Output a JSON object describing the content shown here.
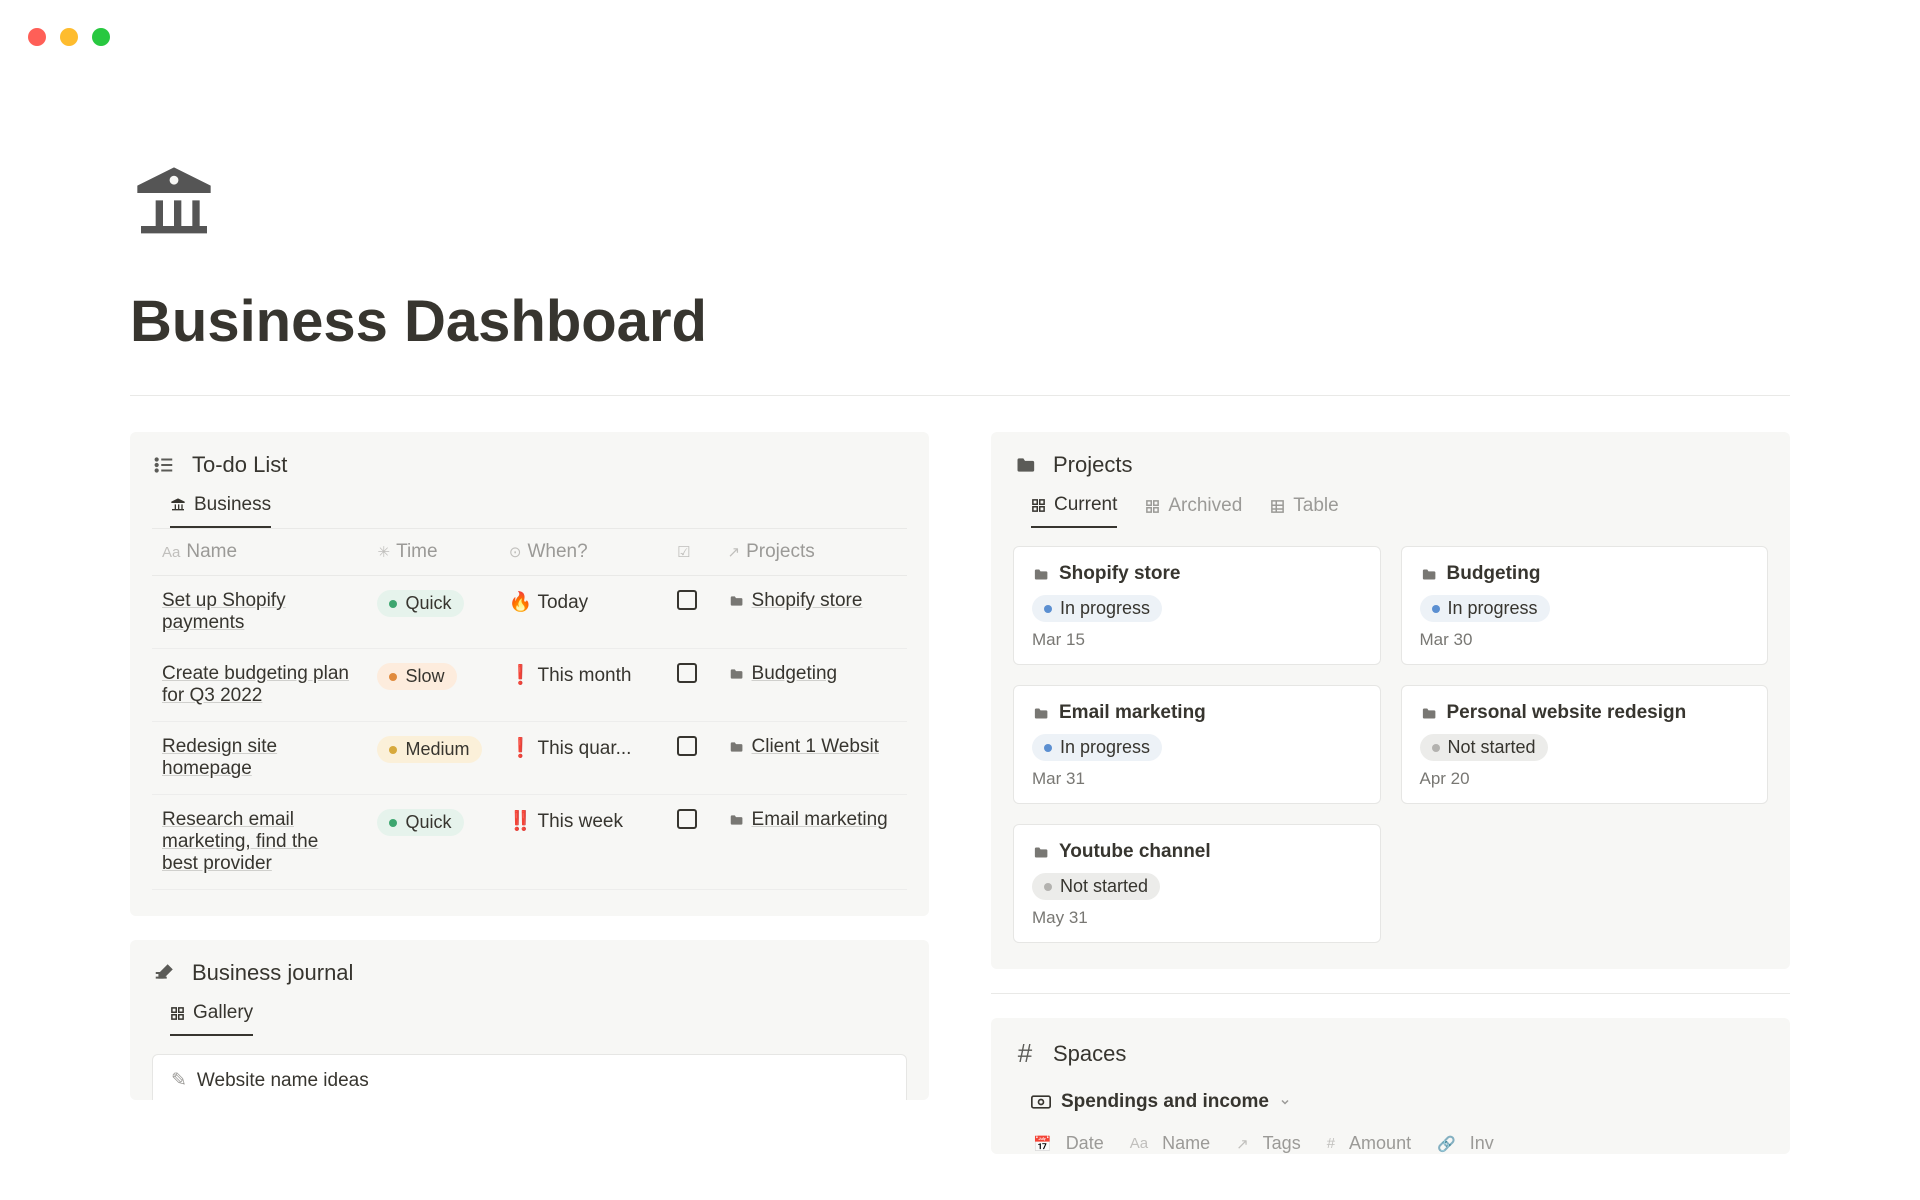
{
  "page": {
    "title": "Business Dashboard",
    "icon": "bank-icon"
  },
  "todo": {
    "title": "To-do List",
    "tabs": [
      {
        "label": "Business",
        "icon": "bank",
        "active": true
      }
    ],
    "columns": {
      "name": "Name",
      "time": "Time",
      "when": "When?",
      "projects": "Projects"
    },
    "rows": [
      {
        "name": "Set up Shopify payments",
        "time": "Quick",
        "time_color": "green",
        "when_icon": "🔥",
        "when": "Today",
        "project": "Shopify store"
      },
      {
        "name": "Create budgeting plan for Q3 2022",
        "time": "Slow",
        "time_color": "orange",
        "when_icon": "❗",
        "when": "This month",
        "project": "Budgeting"
      },
      {
        "name": "Redesign site homepage",
        "time": "Medium",
        "time_color": "yellow",
        "when_icon": "❗",
        "when": "This quar...",
        "project": "Client 1 Websit"
      },
      {
        "name": "Research email marketing, find the best provider",
        "time": "Quick",
        "time_color": "green",
        "when_icon": "‼️",
        "when": "This week",
        "project": "Email marketing"
      }
    ]
  },
  "journal": {
    "title": "Business journal",
    "tabs": [
      {
        "label": "Gallery",
        "active": true
      }
    ],
    "items": [
      {
        "title": "Website name ideas"
      }
    ]
  },
  "projects": {
    "title": "Projects",
    "tabs": [
      {
        "label": "Current",
        "icon": "board",
        "active": true
      },
      {
        "label": "Archived",
        "icon": "board",
        "active": false
      },
      {
        "label": "Table",
        "icon": "table",
        "active": false
      }
    ],
    "cards": [
      {
        "title": "Shopify store",
        "status": "In progress",
        "status_color": "blue",
        "date": "Mar 15"
      },
      {
        "title": "Budgeting",
        "status": "In progress",
        "status_color": "blue",
        "date": "Mar 30"
      },
      {
        "title": "Email marketing",
        "status": "In progress",
        "status_color": "blue",
        "date": "Mar 31"
      },
      {
        "title": "Personal website redesign",
        "status": "Not started",
        "status_color": "grey",
        "date": "Apr 20"
      },
      {
        "title": "Youtube channel",
        "status": "Not started",
        "status_color": "grey",
        "date": "May 31"
      }
    ]
  },
  "spaces": {
    "title": "Spaces",
    "subview": "Spendings and income",
    "columns": [
      "Date",
      "Name",
      "Tags",
      "Amount",
      "Inv"
    ]
  }
}
